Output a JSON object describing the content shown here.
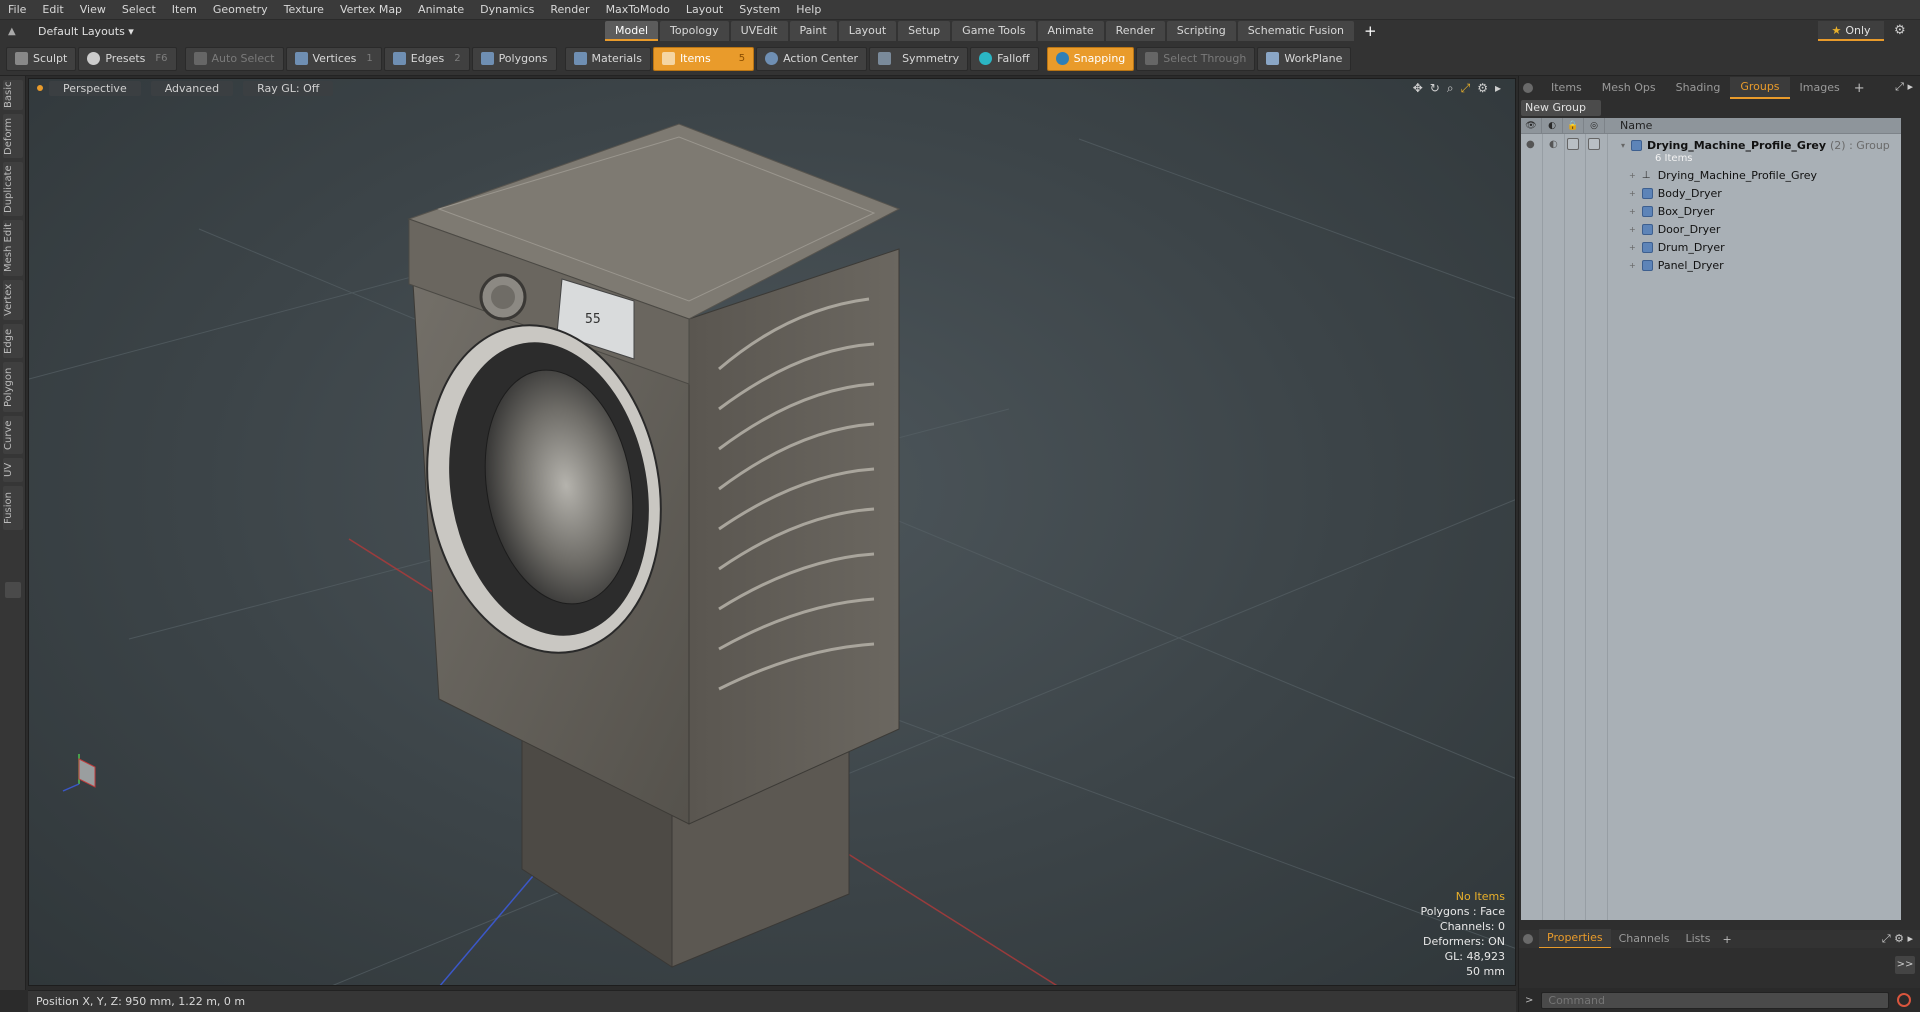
{
  "menu": [
    "File",
    "Edit",
    "View",
    "Select",
    "Item",
    "Geometry",
    "Texture",
    "Vertex Map",
    "Animate",
    "Dynamics",
    "Render",
    "MaxToModo",
    "Layout",
    "System",
    "Help"
  ],
  "layout_dropdown": "Default Layouts ▾",
  "layout_tabs": [
    {
      "label": "Model",
      "active": true
    },
    {
      "label": "Topology"
    },
    {
      "label": "UVEdit"
    },
    {
      "label": "Paint"
    },
    {
      "label": "Layout"
    },
    {
      "label": "Setup"
    },
    {
      "label": "Game Tools"
    },
    {
      "label": "Animate"
    },
    {
      "label": "Render"
    },
    {
      "label": "Scripting"
    },
    {
      "label": "Schematic Fusion"
    }
  ],
  "layout_tabs_add": "+",
  "only_label": "Only",
  "toolbar": {
    "sculpt": "Sculpt",
    "presets": "Presets",
    "presets_key": "F6",
    "auto_select": "Auto Select",
    "vertices": "Vertices",
    "vertices_count": "1",
    "edges": "Edges",
    "edges_count": "2",
    "polygons": "Polygons",
    "materials": "Materials",
    "items": "Items",
    "items_count": "5",
    "action_center": "Action Center",
    "symmetry": "Symmetry",
    "falloff": "Falloff",
    "snapping": "Snapping",
    "select_through": "Select Through",
    "workplane": "WorkPlane"
  },
  "left_tabs": [
    "Basic",
    "Deform",
    "Duplicate",
    "Mesh Edit",
    "Vertex",
    "Edge",
    "Polygon",
    "Curve",
    "UV",
    "Fusion"
  ],
  "viewport": {
    "view": "Perspective",
    "mode": "Advanced",
    "raygl": "Ray GL: Off",
    "stats": {
      "no_items": "No Items",
      "polygons": "Polygons : Face",
      "channels": "Channels: 0",
      "deformers": "Deformers: ON",
      "gl": "GL: 48,923",
      "grid": "50 mm"
    },
    "panel_display": "55"
  },
  "statusbar": "Position X, Y, Z:  950 mm, 1.22 m, 0 m",
  "right_panel": {
    "tabs": [
      {
        "label": "Items"
      },
      {
        "label": "Mesh Ops"
      },
      {
        "label": "Shading"
      },
      {
        "label": "Groups",
        "active": true
      },
      {
        "label": "Images"
      }
    ],
    "tabs_add": "+",
    "new_group": "New Group",
    "col_name": "Name",
    "group": {
      "name": "Drying_Machine_Profile_Grey",
      "suffix": "(2) : Group",
      "count": "6 Items",
      "children": [
        "Drying_Machine_Profile_Grey",
        "Body_Dryer",
        "Box_Dryer",
        "Door_Dryer",
        "Drum_Dryer",
        "Panel_Dryer"
      ]
    },
    "prop_tabs": [
      {
        "label": "Properties",
        "active": true
      },
      {
        "label": "Channels"
      },
      {
        "label": "Lists"
      }
    ],
    "prop_tabs_add": "+",
    "command_placeholder": "Command",
    "ffw": ">>"
  },
  "colors": {
    "accent": "#e99b2b",
    "viewport_bg": "#3c4448",
    "panel_bg": "#a9b0b6"
  }
}
